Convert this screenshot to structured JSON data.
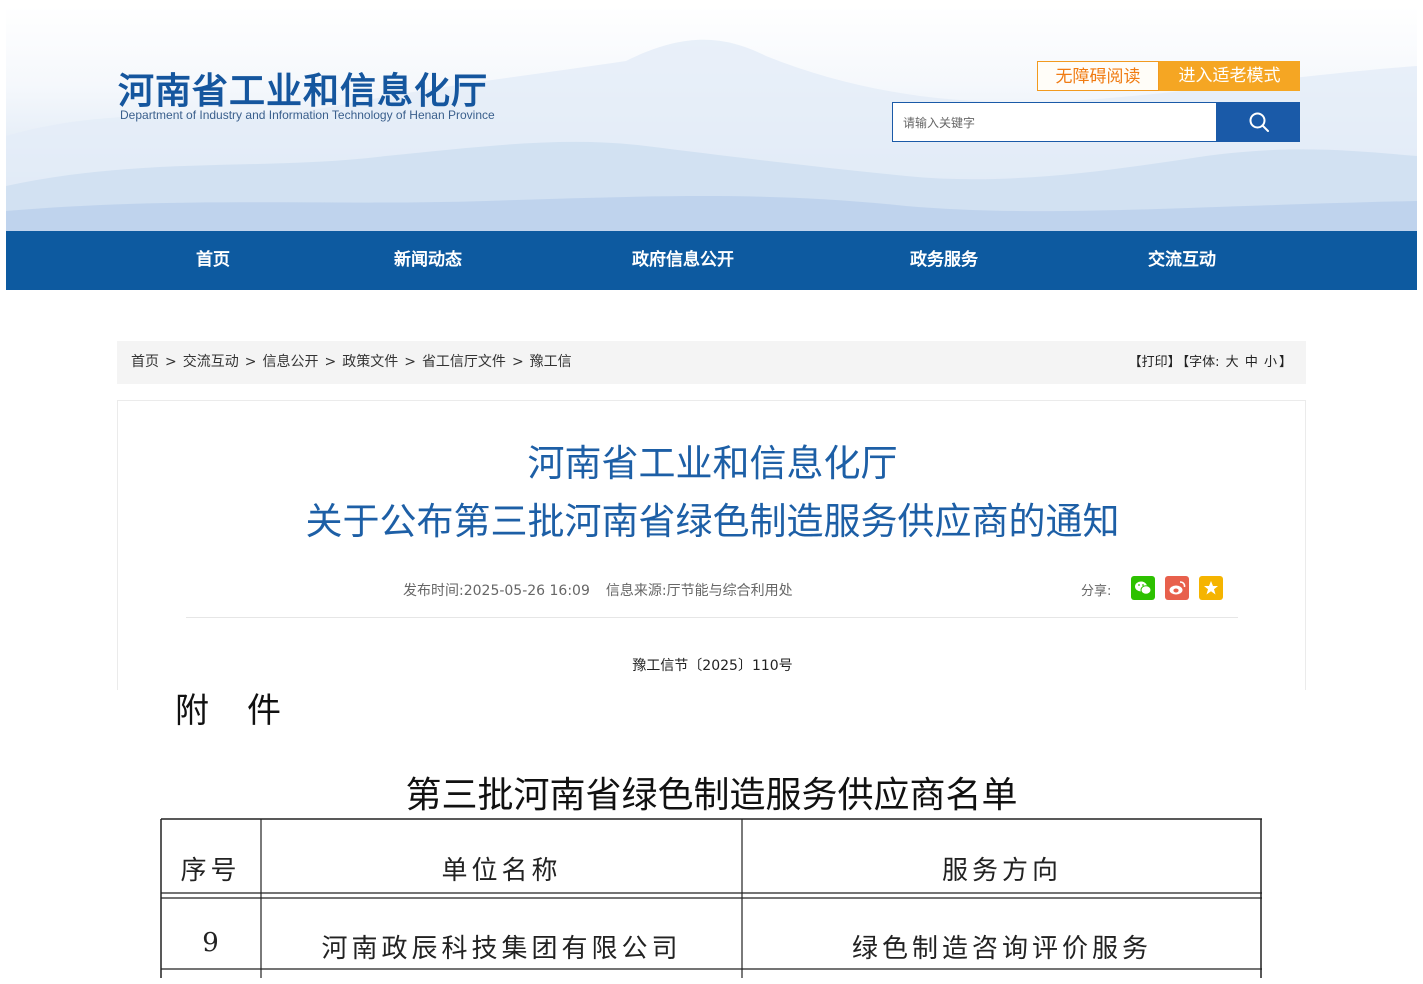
{
  "header": {
    "title": "河南省工业和信息化厅",
    "subtitle": "Department of Industry and Information Technology of Henan Province",
    "accessibility_label": "无障碍阅读",
    "elder_mode_label": "进入适老模式",
    "search_placeholder": "请输入关键字"
  },
  "nav": [
    "首页",
    "新闻动态",
    "政府信息公开",
    "政务服务",
    "交流互动"
  ],
  "breadcrumb": [
    "首页",
    "交流互动",
    "信息公开",
    "政策文件",
    "省工信厅文件",
    "豫工信"
  ],
  "tools": {
    "print": "【打印】",
    "font_prefix": "【字体:",
    "large": "大",
    "medium": "中",
    "small": "小",
    "font_suffix": "】"
  },
  "article": {
    "title_line1": "河南省工业和信息化厅",
    "title_line2": "关于公布第三批河南省绿色制造服务供应商的通知",
    "publish_time": "发布时间:2025-05-26 16:09",
    "source": "信息来源:厅节能与综合利用处",
    "share_label": "分享:",
    "doc_number": "豫工信节〔2025〕110号"
  },
  "share_icons": [
    "wechat-icon",
    "weibo-icon",
    "favorite-icon"
  ],
  "colors": {
    "brand_blue": "#0d5aa0",
    "title_blue": "#1d5fa6",
    "orange": "#f5a623",
    "wechat": "#2dc100",
    "weibo": "#e8604c",
    "favorite": "#f5b400"
  },
  "attachment": {
    "label_a": "附",
    "label_b": "件",
    "list_title": "第三批河南省绿色制造服务供应商名单",
    "headers": [
      "序号",
      "单位名称",
      "服务方向"
    ],
    "rows": [
      [
        "9",
        "河南政辰科技集团有限公司",
        "绿色制造咨询评价服务"
      ]
    ]
  }
}
